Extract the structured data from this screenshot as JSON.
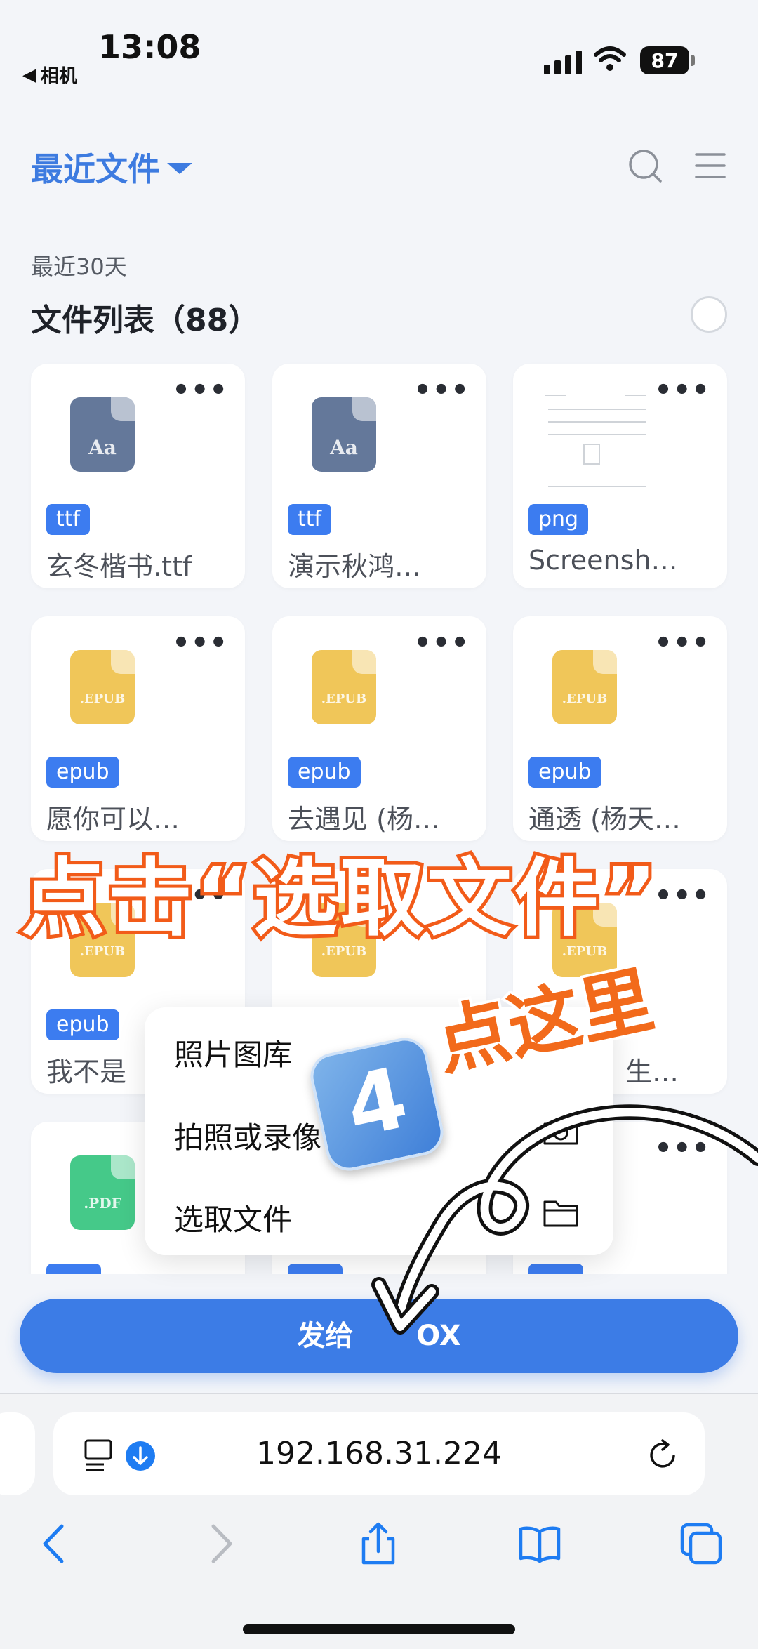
{
  "status_bar": {
    "time": "13:08",
    "back_app": "相机",
    "battery": "87"
  },
  "header": {
    "title": "最近文件"
  },
  "section": {
    "sub_label": "最近30天",
    "list_title": "文件列表（88）"
  },
  "files": [
    {
      "type": "ttf",
      "name": "玄冬楷书.ttf",
      "icon": "font-file-icon",
      "icon_label": "Aa"
    },
    {
      "type": "ttf",
      "name": "演示秋鸿…",
      "icon": "font-file-icon",
      "icon_label": "Aa"
    },
    {
      "type": "png",
      "name": "Screensh…",
      "icon": "screenshot-thumbnail"
    },
    {
      "type": "epub",
      "name": "愿你可以…",
      "icon": "epub-file-icon",
      "icon_label": ".EPUB"
    },
    {
      "type": "epub",
      "name": "去遇见 (杨…",
      "icon": "epub-file-icon",
      "icon_label": ".EPUB"
    },
    {
      "type": "epub",
      "name": "通透 (杨天…",
      "icon": "epub-file-icon",
      "icon_label": ".EPUB"
    },
    {
      "type": "epub",
      "name": "我不是",
      "icon": "epub-file-icon",
      "icon_label": ".EPUB"
    },
    {
      "type": "",
      "name": "",
      "icon": "epub-file-icon",
      "icon_label": ".EPUB"
    },
    {
      "type": "",
      "name": "生…",
      "icon": "epub-file-icon",
      "icon_label": ".EPUB"
    },
    {
      "type": "",
      "name": "",
      "icon": "pdf-file-icon",
      "icon_label": ".PDF"
    },
    {
      "type": "",
      "name": "",
      "icon": "file-icon"
    },
    {
      "type": "",
      "name": "",
      "icon": "file-icon"
    }
  ],
  "overlay": {
    "banner": "点击“选取文件”",
    "step_number": "4",
    "tap_hint": "点这里"
  },
  "menu": {
    "items": [
      {
        "label": "照片图库",
        "icon": ""
      },
      {
        "label": "拍照或录像",
        "icon": "camera-icon"
      },
      {
        "label": "选取文件",
        "icon": "folder-icon"
      }
    ]
  },
  "send_button": {
    "label_visible": "发给",
    "label_tail": "OX"
  },
  "browser": {
    "url": "192.168.31.224"
  },
  "colors": {
    "accent": "#3d7be0",
    "tag": "#3c7cf0",
    "overlay_orange": "#f25b19"
  }
}
